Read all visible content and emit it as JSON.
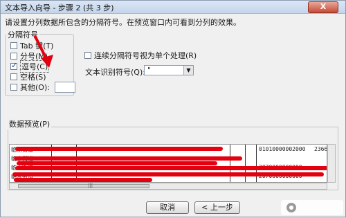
{
  "window": {
    "title": "文本导入向导 - 步骤 2 (共 3 步)",
    "close_label": "X",
    "instruction": "请设置分列数据所包含的分隔符号。在预览窗口内可看到分列的效果。"
  },
  "delimiters": {
    "group_title": "分隔符号",
    "options": [
      {
        "label": "Tab 键(T)",
        "checked": false
      },
      {
        "label": "分号(M)",
        "checked": false
      },
      {
        "label": "逗号(C)",
        "checked": true
      },
      {
        "label": "空格(S)",
        "checked": false
      },
      {
        "label": "其他(O):",
        "checked": false
      }
    ],
    "other_value": ""
  },
  "options": {
    "consecutive_label": "连续分隔符号视为单个处理(R)",
    "consecutive_checked": false,
    "text_qualifier_label": "文本识别符号(Q):",
    "text_qualifier_value": "\""
  },
  "preview": {
    "label": "数据预览(P)",
    "rows": [
      {
        "col1": "临水街道",
        "digits": "01010000002000",
        "tail": "2366"
      },
      {
        "col1": "临水街道",
        "digits": "",
        "tail": ""
      },
      {
        "col1": "临水街道",
        "digits": "2070000000000",
        "tail": ""
      },
      {
        "col1": "临水街道",
        "digits": "2070000000000",
        "tail": ""
      }
    ]
  },
  "buttons": {
    "cancel": "取消",
    "back": "< 上一步"
  },
  "colors": {
    "annotation_red": "#e3000f",
    "titlebar": "#c4d5ea"
  }
}
